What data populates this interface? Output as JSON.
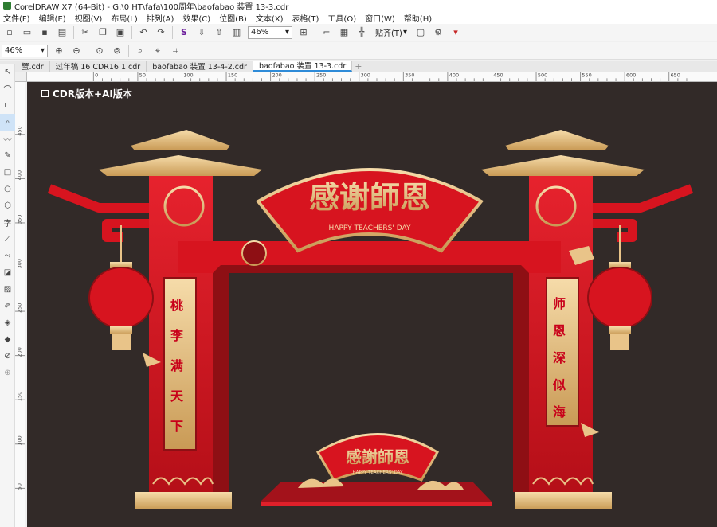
{
  "window": {
    "title": "CorelDRAW X7 (64-Bit) - G:\\0 HT\\fafa\\100周年\\baofabao 装置 13-3.cdr"
  },
  "menu": [
    "文件(F)",
    "编辑(E)",
    "视图(V)",
    "布局(L)",
    "排列(A)",
    "效果(C)",
    "位图(B)",
    "文本(X)",
    "表格(T)",
    "工具(O)",
    "窗口(W)",
    "帮助(H)"
  ],
  "toolbar": {
    "zoom": "46%",
    "snap_label": "贴齐(T)"
  },
  "propbar": {
    "zoom": "46%"
  },
  "tabs": [
    {
      "label": "蟹.cdr",
      "active": false
    },
    {
      "label": "过年稿 16 CDR16 1.cdr",
      "active": false
    },
    {
      "label": "baofabao 装置 13-4-2.cdr",
      "active": false
    },
    {
      "label": "baofabao 装置 13-3.cdr",
      "active": true
    }
  ],
  "ruler": {
    "h_ticks": [
      "50",
      "0",
      "50",
      "100",
      "150",
      "200",
      "250",
      "300",
      "350",
      "400",
      "450",
      "500",
      "550",
      "600",
      "650",
      "700"
    ],
    "v_ticks": [
      "450",
      "400",
      "350",
      "300",
      "250",
      "200",
      "150",
      "100",
      "50"
    ]
  },
  "canvas": {
    "caption": "CDR版本+AI版本",
    "main_title": "感谢師恩",
    "subtitle": "HAPPY TEACHERS' DAY",
    "left_couplet": [
      "桃",
      "李",
      "满",
      "天",
      "下"
    ],
    "right_couplet": [
      "师",
      "恩",
      "深",
      "似",
      "海"
    ],
    "small_title": "感謝師恩",
    "small_subtitle": "HAPPY TEACHERS' DAY"
  },
  "colors": {
    "canvas_bg": "#322a28",
    "red": "#d7141f",
    "dark_red": "#8e0f14",
    "gold": "#e9c489",
    "accent_blue": "#2e8bd8"
  }
}
